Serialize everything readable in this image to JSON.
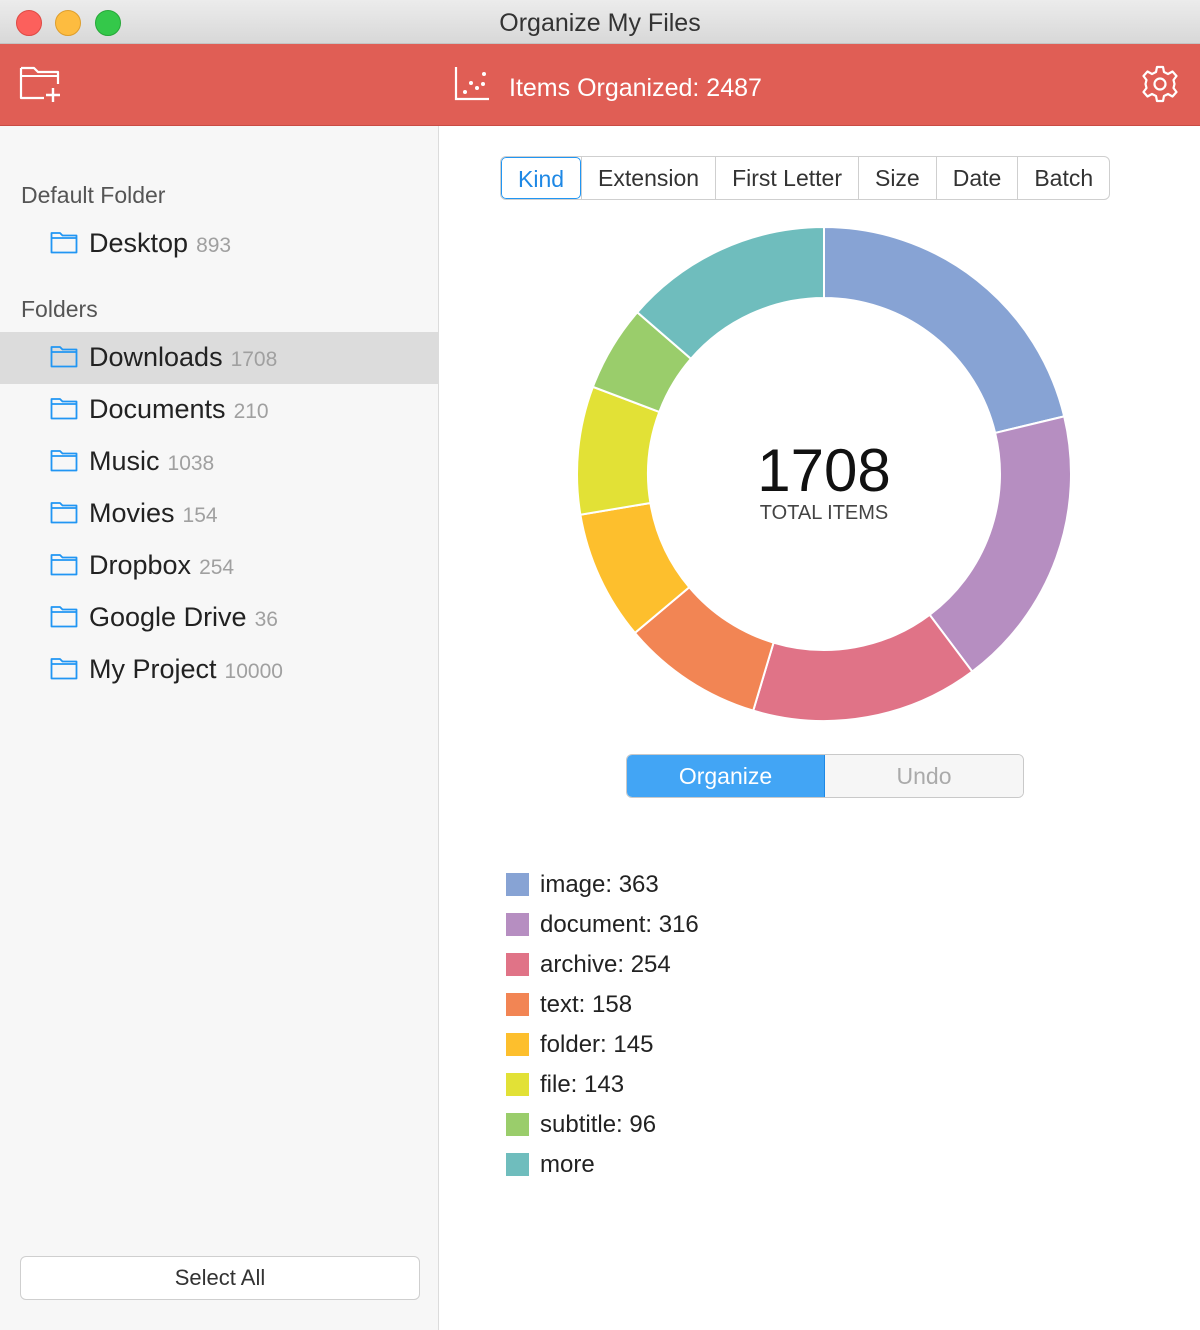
{
  "window": {
    "title": "Organize My Files"
  },
  "toolbar": {
    "items_organized": "Items Organized: 2487"
  },
  "sidebar": {
    "default_section": "Default Folder",
    "default_folder": {
      "name": "Desktop",
      "count": "893"
    },
    "folders_section": "Folders",
    "folders": [
      {
        "name": "Downloads",
        "count": "1708"
      },
      {
        "name": "Documents",
        "count": "210"
      },
      {
        "name": "Music",
        "count": "1038"
      },
      {
        "name": "Movies",
        "count": "154"
      },
      {
        "name": "Dropbox",
        "count": "254"
      },
      {
        "name": "Google Drive",
        "count": "36"
      },
      {
        "name": "My Project",
        "count": "10000"
      }
    ],
    "select_all_label": "Select All"
  },
  "tabs": [
    "Kind",
    "Extension",
    "First Letter",
    "Size",
    "Date",
    "Batch"
  ],
  "center": {
    "total": "1708",
    "label": "TOTAL ITEMS"
  },
  "actions": {
    "organize": "Organize",
    "undo": "Undo"
  },
  "legend": [
    {
      "label": "image: 363",
      "color": "#87a3d4"
    },
    {
      "label": "document: 316",
      "color": "#b68ec1"
    },
    {
      "label": "archive: 254",
      "color": "#e07387"
    },
    {
      "label": "text: 158",
      "color": "#f28554"
    },
    {
      "label": "folder: 145",
      "color": "#fdbf2d"
    },
    {
      "label": "file: 143",
      "color": "#e2e136"
    },
    {
      "label": "subtitle: 96",
      "color": "#9acd6b"
    },
    {
      "label": "more",
      "color": "#6fbdbd"
    }
  ],
  "chart_data": {
    "type": "pie",
    "categories": [
      "image",
      "document",
      "archive",
      "text",
      "folder",
      "file",
      "subtitle",
      "more"
    ],
    "values": [
      363,
      316,
      254,
      158,
      145,
      143,
      96,
      233
    ],
    "colors": [
      "#87a3d4",
      "#b68ec1",
      "#e07387",
      "#f28554",
      "#fdbf2d",
      "#e2e136",
      "#9acd6b",
      "#6fbdbd"
    ],
    "title": "",
    "donut": true
  }
}
